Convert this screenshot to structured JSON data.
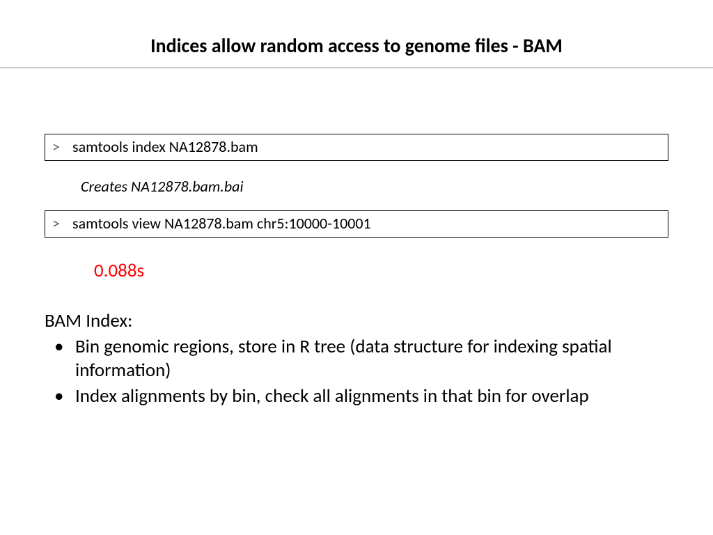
{
  "title": "Indices allow random access to genome files - BAM",
  "commands": {
    "prompt": ">",
    "cmd1": "samtools index NA12878.bam",
    "creates": "Creates NA12878.bam.bai",
    "cmd2": "samtools view NA12878.bam chr5:10000-10001"
  },
  "timing": "0.088s",
  "body": {
    "heading": "BAM Index:",
    "bullets": [
      "Bin genomic regions, store in R tree (data structure for indexing spatial information)",
      "Index alignments by bin, check all alignments in that bin for overlap"
    ]
  }
}
